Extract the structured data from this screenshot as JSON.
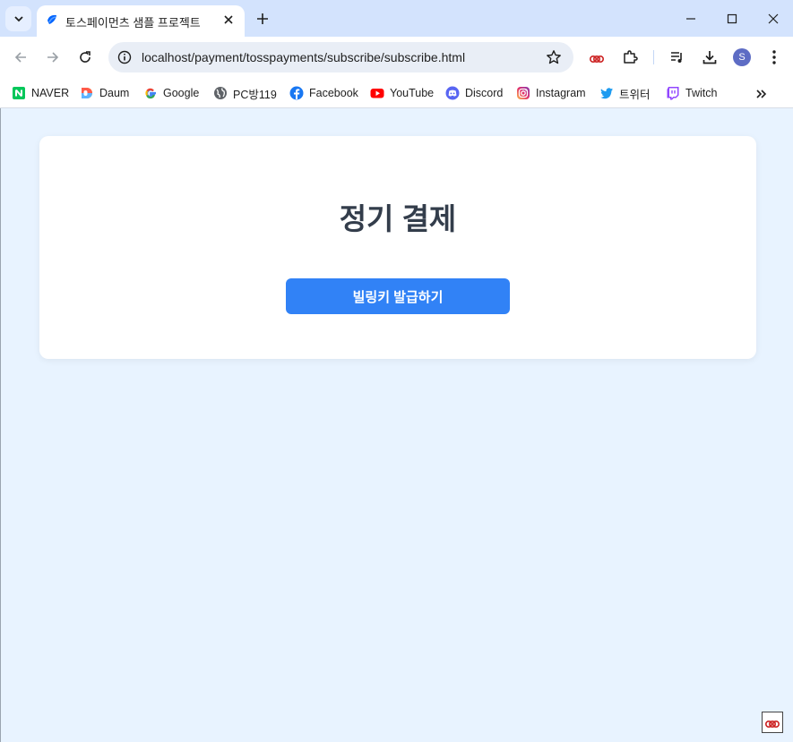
{
  "tab": {
    "title": "토스페이먼츠 샘플 프로젝트"
  },
  "omnibox": {
    "url": "localhost/payment/tosspayments/subscribe/subscribe.html"
  },
  "profile": {
    "initial": "S"
  },
  "bookmarks": [
    {
      "label": "NAVER",
      "icon": "naver-icon",
      "color": "#03c75a"
    },
    {
      "label": "Daum",
      "icon": "daum-icon",
      "color": "#ff5a4a"
    },
    {
      "label": "Google",
      "icon": "google-icon",
      "color": "#4285f4"
    },
    {
      "label": "PC방119",
      "icon": "globe-icon",
      "color": "#5f6368"
    },
    {
      "label": "Facebook",
      "icon": "facebook-icon",
      "color": "#1877f2"
    },
    {
      "label": "YouTube",
      "icon": "youtube-icon",
      "color": "#ff0000"
    },
    {
      "label": "Discord",
      "icon": "discord-icon",
      "color": "#5865f2"
    },
    {
      "label": "Instagram",
      "icon": "instagram-icon",
      "color": "#e1306c"
    },
    {
      "label": "트위터",
      "icon": "twitter-icon",
      "color": "#1d9bf0"
    },
    {
      "label": "Twitch",
      "icon": "twitch-icon",
      "color": "#9146ff"
    }
  ],
  "page": {
    "title": "정기 결제",
    "billing_button_label": "빌링키 발급하기"
  },
  "colors": {
    "page_background": "#e8f3ff",
    "primary_button": "#3182f6",
    "title_text": "#333d4b"
  }
}
